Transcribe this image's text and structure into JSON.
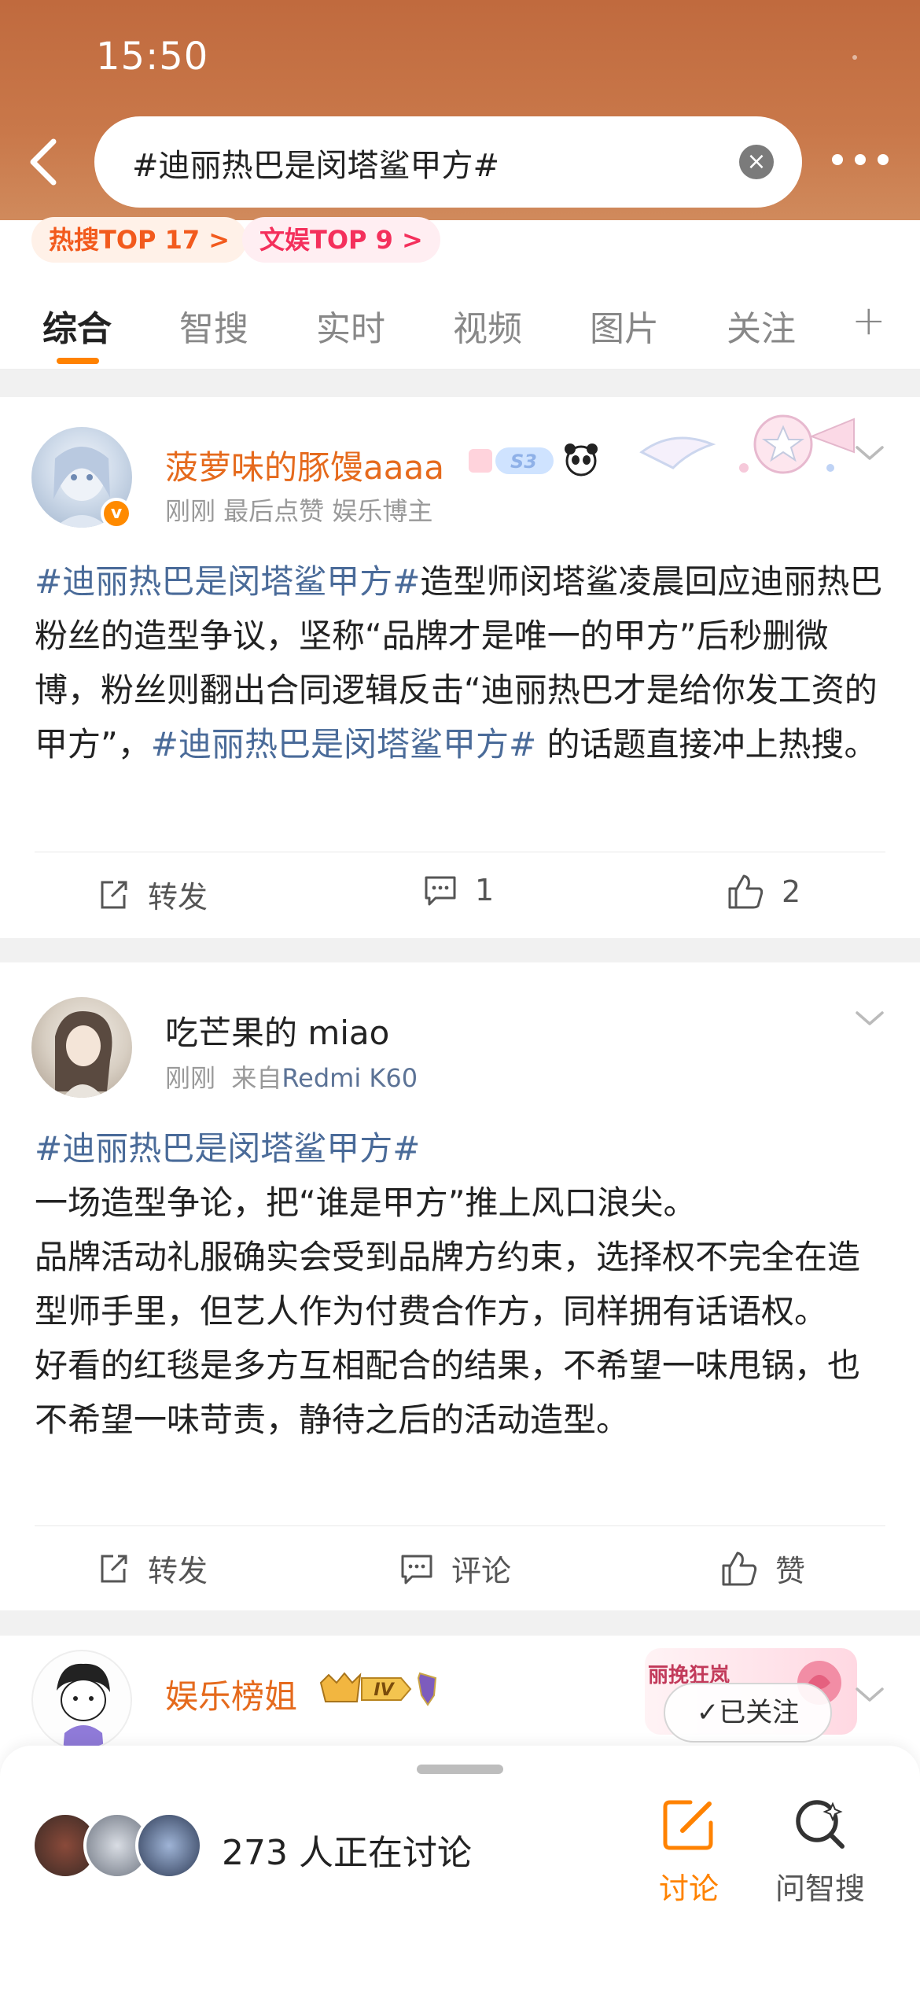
{
  "status_bar": {
    "time": "15:50"
  },
  "search": {
    "query": "#迪丽热巴是闵塔鲨甲方#"
  },
  "badges": [
    {
      "label": "热搜TOP 17 >"
    },
    {
      "label": "文娱TOP 9 >"
    }
  ],
  "tabs": [
    "综合",
    "智搜",
    "实时",
    "视频",
    "图片",
    "关注"
  ],
  "posts": [
    {
      "username": "菠萝味的豚馒aaaa",
      "level_badge": "S3",
      "meta": "刚刚 最后点赞  娱乐博主",
      "content_parts": [
        {
          "text": "#迪丽热巴是闵塔鲨甲方#",
          "tag": true
        },
        {
          "text": "造型师闵塔鲨凌晨回应迪丽热巴粉丝的造型争议，坚称“品牌才是唯一的甲方”后秒删微博，粉丝则翻出合同逻辑反击“迪丽热巴才是给你发工资的甲方”，",
          "tag": false
        },
        {
          "text": "#迪丽热巴是闵塔鲨甲方#",
          "tag": true
        },
        {
          "text": " 的话题直接冲上热搜。",
          "tag": false
        }
      ],
      "actions": {
        "repost": "转发",
        "comment": "1",
        "like": "2"
      }
    },
    {
      "username": "吃芒果的 miao",
      "meta_time": "刚刚",
      "meta_source_prefix": "来自",
      "meta_source": "Redmi K60",
      "content_tag": "#迪丽热巴是闵塔鲨甲方#",
      "content_lines": [
        "一场造型争论，把“谁是甲方”推上风口浪尖。",
        "品牌活动礼服确实会受到品牌方约束，选择权不完全在造型师手里，但艺人作为付费合作方，同样拥有话语权。",
        "好看的红毯是多方互相配合的结果，不希望一味甩锅，也不希望一味苛责，静待之后的活动造型。"
      ],
      "actions": {
        "repost": "转发",
        "comment": "评论",
        "like": "赞"
      }
    },
    {
      "username": "娱乐榜姐",
      "level_badge": "IV",
      "promo": "丽挽狂岚",
      "follow_label": "✓已关注"
    }
  ],
  "bottom_sheet": {
    "discussing": "273 人正在讨论",
    "discuss_label": "讨论",
    "ask_label": "问智搜"
  },
  "colors": {
    "accent": "#ff8200",
    "tag": "#4a6b99",
    "header": "#c06a3e"
  }
}
